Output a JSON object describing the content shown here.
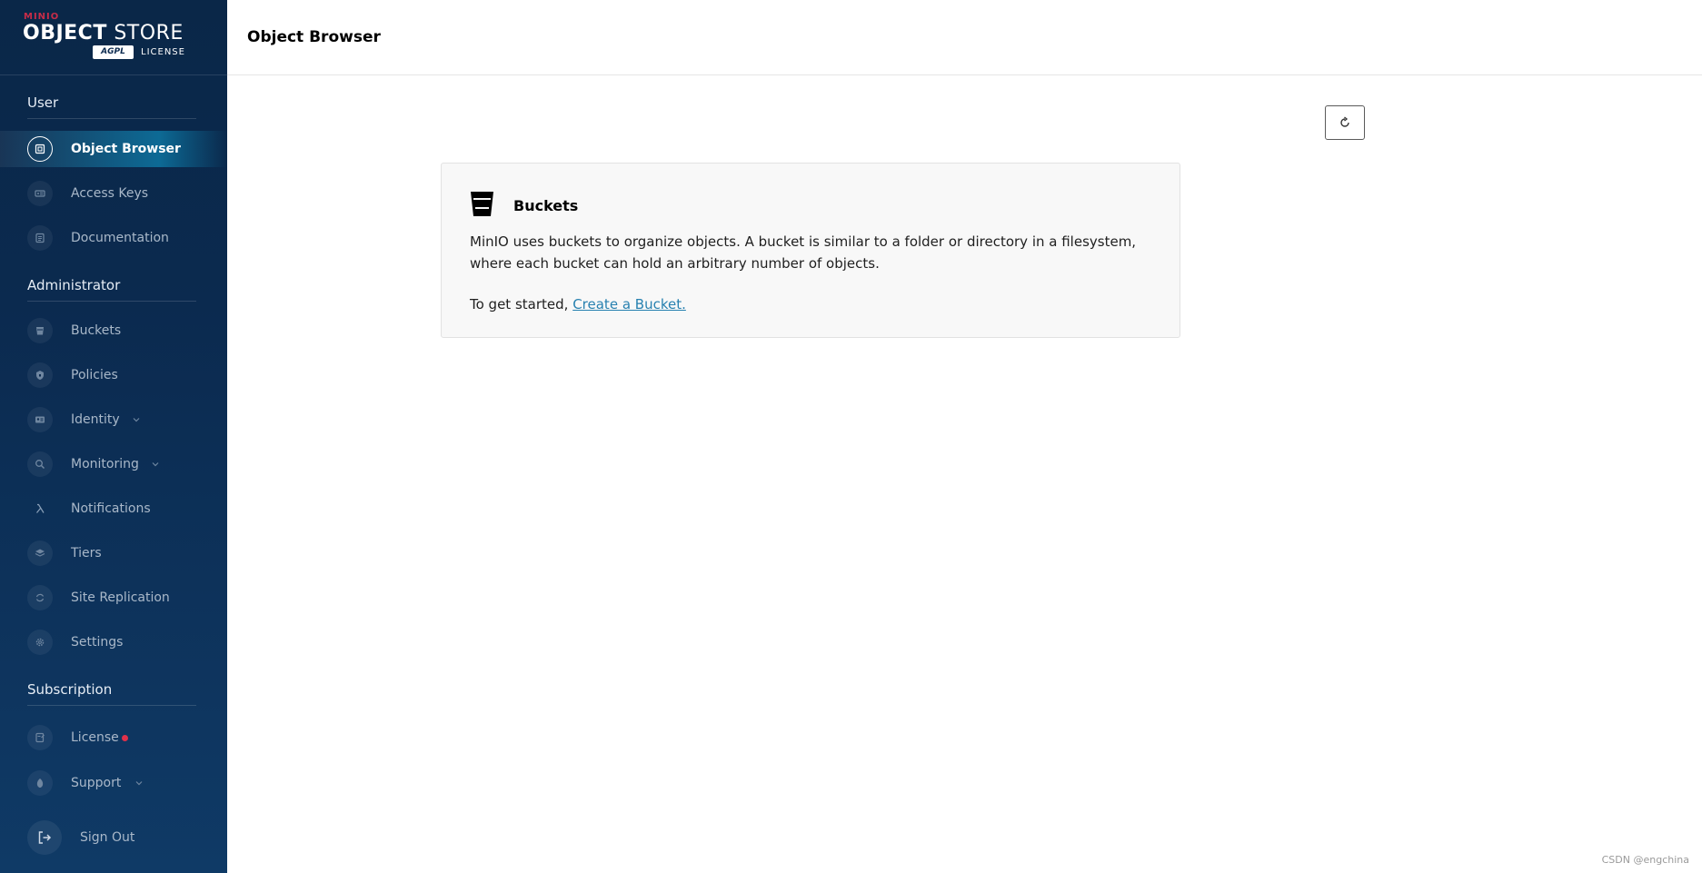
{
  "logo": {
    "brand": "MINIO",
    "product_bold": "OBJECT",
    "product_light": "STORE",
    "badge": "AGPL",
    "license_text": "LICENSE"
  },
  "sidebar": {
    "sections": {
      "user": "User",
      "administrator": "Administrator",
      "subscription": "Subscription"
    },
    "items": [
      {
        "label": "Object Browser",
        "icon": "object-browser-icon",
        "active": true
      },
      {
        "label": "Access Keys",
        "icon": "key-icon"
      },
      {
        "label": "Documentation",
        "icon": "documentation-icon"
      },
      {
        "label": "Buckets",
        "icon": "bucket-icon"
      },
      {
        "label": "Policies",
        "icon": "policy-icon"
      },
      {
        "label": "Identity",
        "icon": "identity-icon",
        "expandable": true
      },
      {
        "label": "Monitoring",
        "icon": "monitoring-icon",
        "expandable": true
      },
      {
        "label": "Notifications",
        "icon": "lambda-icon"
      },
      {
        "label": "Tiers",
        "icon": "tiers-icon"
      },
      {
        "label": "Site Replication",
        "icon": "replication-icon"
      },
      {
        "label": "Settings",
        "icon": "gear-icon"
      },
      {
        "label": "License",
        "icon": "license-icon",
        "notification_dot": true
      },
      {
        "label": "Support",
        "icon": "support-icon",
        "expandable": true
      }
    ],
    "sign_out": "Sign Out"
  },
  "header": {
    "title": "Object Browser"
  },
  "main": {
    "refresh_icon": "refresh-icon",
    "card": {
      "title": "Buckets",
      "description": "MinIO uses buckets to organize objects. A bucket is similar to a folder or directory in a filesystem, where each bucket can hold an arbitrary number of objects.",
      "start_prefix": "To get started,",
      "link": "Create a Bucket."
    }
  },
  "watermark": "CSDN @engchina",
  "colors": {
    "sidebar_bg": "#0b2a4f",
    "active_highlight": "#0d6a95",
    "brand_red": "#c72c48",
    "link": "#2781b0",
    "notification_dot": "#e0314a"
  }
}
